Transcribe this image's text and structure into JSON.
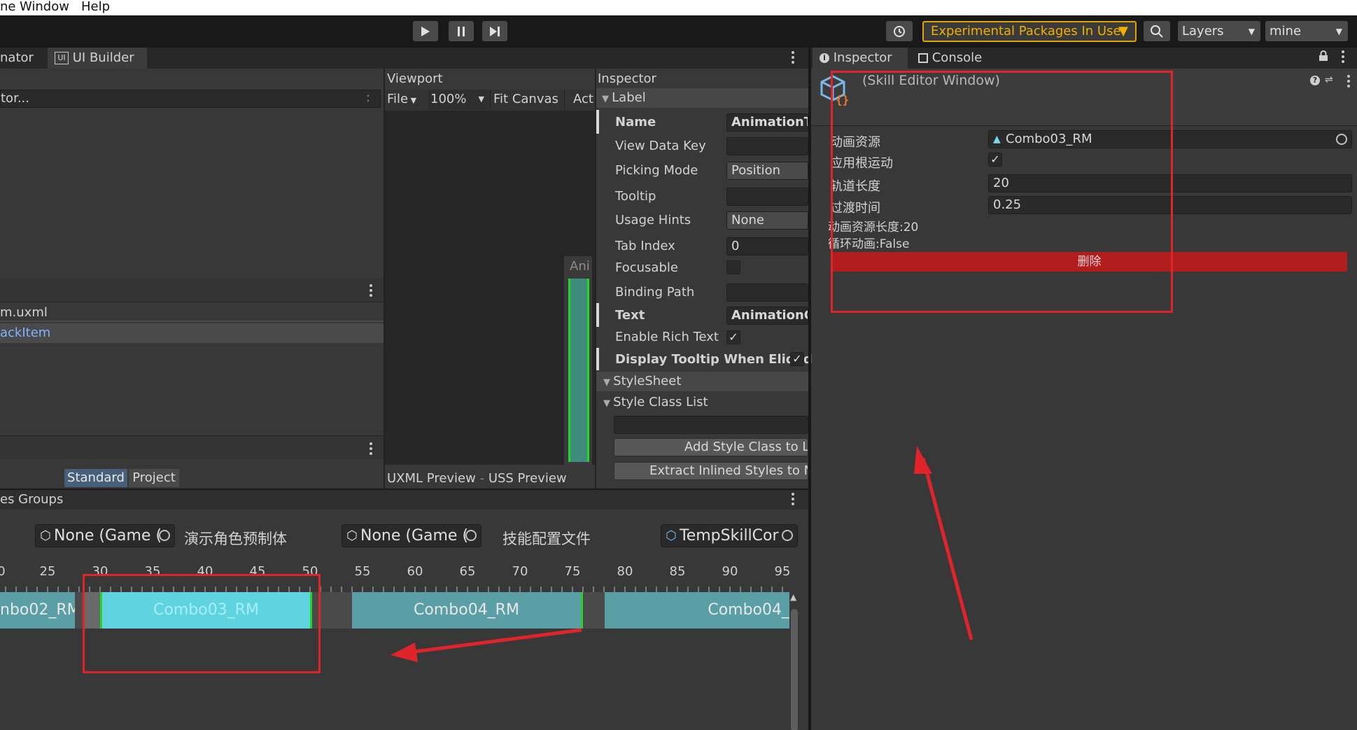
{
  "menu": {
    "items": [
      "ne",
      "Window",
      "Help"
    ]
  },
  "toolbar": {
    "play_icon": "play-icon",
    "pause_icon": "pause-icon",
    "step_icon": "step-icon",
    "history_icon": "history-icon",
    "experimental_label": "Experimental Packages In Use",
    "search_icon": "search-icon",
    "layers_label": "Layers",
    "layout_label": "mine",
    "accent_color": "#f0b000"
  },
  "left_panel": {
    "tabs": [
      "nator",
      "UI Builder"
    ],
    "ui_builder_icon": "ui-builder-icon",
    "search_text": "tor...",
    "hierarchy_items": [
      "m.uxml",
      "ackItem"
    ],
    "library_tabs": [
      "Standard",
      "Project"
    ]
  },
  "viewport": {
    "title": "Viewport",
    "file_label": "File",
    "zoom_label": "100%",
    "fit_canvas_label": "Fit Canvas",
    "act_label": "Act",
    "ani_label": "Ani",
    "bottom_tabs": [
      "UXML Preview",
      "USS Preview"
    ]
  },
  "builder_inspector": {
    "title": "Inspector",
    "section_label": "Label",
    "rows": [
      {
        "label": "Name",
        "value": "AnimationTr",
        "bold": true
      },
      {
        "label": "View Data Key",
        "value": ""
      },
      {
        "label": "Picking Mode",
        "value": "Position"
      },
      {
        "label": "Tooltip",
        "value": ""
      },
      {
        "label": "Usage Hints",
        "value": "None"
      },
      {
        "label": "Tab Index",
        "value": "0"
      },
      {
        "label": "Focusable",
        "value": ""
      },
      {
        "label": "Binding Path",
        "value": ""
      },
      {
        "label": "Text",
        "value": "AnimationCl",
        "bold": true
      },
      {
        "label": "Enable Rich Text",
        "value": "✓"
      },
      {
        "label": "Display Tooltip When Elided",
        "value": "✓",
        "bold": true
      }
    ],
    "stylesheet_label": "StyleSheet",
    "style_class_list_label": "Style Class List",
    "add_style_class_label": "Add Style Class to Li",
    "extract_styles_label": "Extract Inlined Styles to Ne"
  },
  "right_inspector": {
    "tabs": [
      "Inspector",
      "Console"
    ],
    "info_icon": "info-icon",
    "console_icon": "console-icon",
    "lock_icon": "lock-icon",
    "component_icon": "script-object-icon",
    "title": "(Skill Editor Window)",
    "help_icon": "help-icon",
    "settings_icon": "preset-icon",
    "fields": [
      {
        "label": "动画资源",
        "value": "Combo03_RM"
      },
      {
        "label": "应用根运动",
        "value": "✓"
      },
      {
        "label": "轨道长度",
        "value": "20"
      },
      {
        "label": "过渡时间",
        "value": "0.25"
      }
    ],
    "info_lines": [
      "动画资源长度:20",
      "循环动画:False"
    ],
    "delete_label": "删除",
    "delete_color": "#b21d1d"
  },
  "skill_editor": {
    "title": "es Groups",
    "object_fields": [
      {
        "value": "None (Game (",
        "caption": "演示角色预制体"
      },
      {
        "value": "None (Game (",
        "caption": "技能配置文件"
      },
      {
        "value": "TempSkillCor",
        "caption": ""
      }
    ],
    "ruler": {
      "labels": [
        "0",
        "25",
        "30",
        "35",
        "40",
        "45",
        "50",
        "55",
        "60",
        "65",
        "70",
        "75",
        "80",
        "85",
        "90",
        "95"
      ]
    },
    "clips": [
      {
        "name": "nbo02_RM",
        "selected": false
      },
      {
        "name": "Combo03_RM",
        "selected": true
      },
      {
        "name": "Combo04_RM",
        "selected": false
      },
      {
        "name": "Combo04_",
        "selected": false
      }
    ],
    "clip_color": "#5a9ea6",
    "selected_clip_color": "#5fd4e0"
  }
}
